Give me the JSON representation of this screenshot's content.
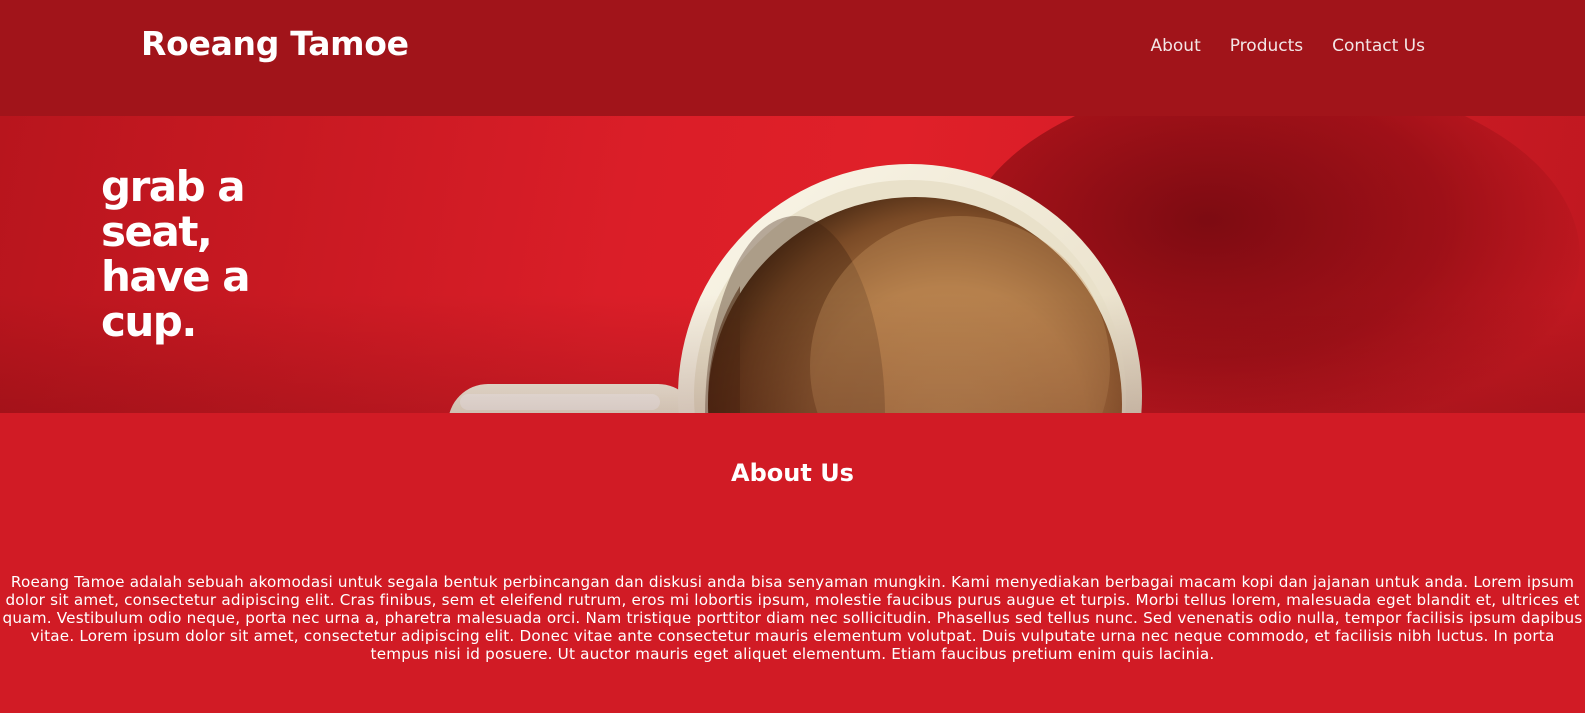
{
  "header": {
    "brand": "Roeang Tamoe",
    "nav": [
      {
        "label": "About"
      },
      {
        "label": "Products"
      },
      {
        "label": "Contact Us"
      }
    ]
  },
  "hero": {
    "tagline": "grab a seat, have a cup."
  },
  "about": {
    "title": "About Us",
    "body": "Roeang Tamoe adalah sebuah akomodasi untuk segala bentuk perbincangan dan diskusi anda bisa senyaman mungkin. Kami menyediakan berbagai macam kopi dan jajanan untuk anda. Lorem ipsum dolor sit amet, consectetur adipiscing elit. Cras finibus, sem et eleifend rutrum, eros mi lobortis ipsum, molestie faucibus purus augue et turpis. Morbi tellus lorem, malesuada eget blandit et, ultrices et quam. Vestibulum odio neque, porta nec urna a, pharetra malesuada orci. Nam tristique porttitor diam nec sollicitudin. Phasellus sed tellus nunc. Sed venenatis odio nulla, tempor facilisis ipsum dapibus vitae. Lorem ipsum dolor sit amet, consectetur adipiscing elit. Donec vitae ante consectetur mauris elementum volutpat. Duis vulputate urna nec neque commodo, et facilisis nibh luctus. In porta tempus nisi id posuere. Ut auctor mauris eget aliquet elementum. Etiam faucibus pretium enim quis lacinia."
  },
  "colors": {
    "header_bg": "#a1141a",
    "page_bg": "#d11b25",
    "coffee": "#b07a45",
    "cup": "#f2ecdc"
  }
}
